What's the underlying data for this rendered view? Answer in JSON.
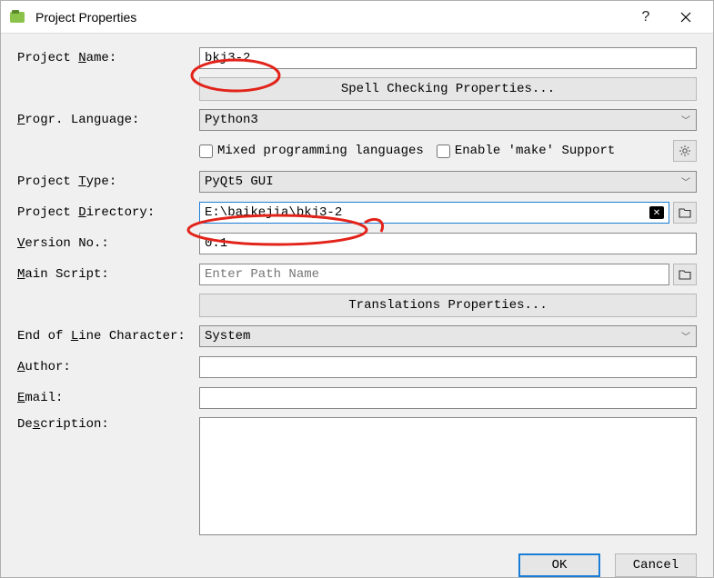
{
  "window": {
    "title": "Project Properties"
  },
  "labels": {
    "project_name": "Project Name:",
    "progr_language": "Progr. Language:",
    "project_type": "Project Type:",
    "project_directory": "Project Directory:",
    "version_no": "Version No.:",
    "main_script": "Main Script:",
    "eol_character": "End of Line Character:",
    "author": "Author:",
    "email": "Email:",
    "description": "Description:"
  },
  "values": {
    "project_name": "bkj3-2",
    "progr_language": "Python3",
    "project_type": "PyQt5 GUI",
    "project_directory": "E:\\baikejia\\bkj3-2",
    "version_no": "0.1",
    "main_script": "",
    "eol_character": "System",
    "author": "",
    "email": "",
    "description": ""
  },
  "placeholders": {
    "main_script": "Enter Path Name"
  },
  "buttons": {
    "spell_check": "Spell Checking Properties...",
    "translations": "Translations Properties...",
    "ok": "OK",
    "cancel": "Cancel"
  },
  "checkboxes": {
    "mixed_lang": "Mixed programming languages",
    "enable_make": "Enable 'make' Support"
  }
}
